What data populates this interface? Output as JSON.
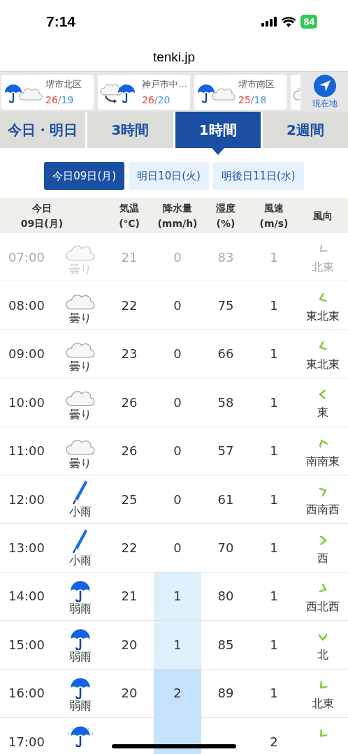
{
  "status_bar": {
    "time": "7:14",
    "battery": "84"
  },
  "site_title": "tenki.jp",
  "locations": [
    {
      "kind": "rain-cloud",
      "name": "堺市北区",
      "high": "26",
      "separator": "/",
      "low": "19"
    },
    {
      "kind": "cloud-then-rain",
      "name": "神戸市中…",
      "high": "26",
      "separator": "/",
      "low": "20"
    },
    {
      "kind": "rain-cloud",
      "name": "堺市南区",
      "high": "25",
      "separator": "/",
      "low": "18"
    },
    {
      "kind": "partial-cloud"
    }
  ],
  "current_location_button": "現在地",
  "tabs": [
    {
      "label": "今日・明日",
      "selected": false
    },
    {
      "label": "3時間",
      "selected": false
    },
    {
      "label": "1時間",
      "selected": true
    },
    {
      "label": "2週間",
      "selected": false
    }
  ],
  "days": [
    {
      "label": "今日09日(月)",
      "selected": true
    },
    {
      "label": "明日10日(火)",
      "selected": false
    },
    {
      "label": "明後日11日(水)",
      "selected": false
    }
  ],
  "table": {
    "columns": [
      [
        "今日",
        "09日(月)"
      ],
      [
        "気温",
        "(℃)"
      ],
      [
        "降水量",
        "(mm/h)"
      ],
      [
        "湿度",
        "(%)"
      ],
      [
        "風速",
        "(m/s)"
      ],
      [
        "風向"
      ]
    ],
    "rows": [
      {
        "time": "07:00",
        "past": true,
        "weather": {
          "kind": "cloudy",
          "label": "曇り"
        },
        "temp": "21",
        "precip": {
          "kind": "none",
          "value": "0"
        },
        "humidity": "83",
        "wind_speed": "1",
        "wind": {
          "kind": "NE",
          "label": "北東"
        }
      },
      {
        "time": "08:00",
        "past": false,
        "weather": {
          "kind": "cloudy",
          "label": "曇り"
        },
        "temp": "22",
        "precip": {
          "kind": "none",
          "value": "0"
        },
        "humidity": "75",
        "wind_speed": "1",
        "wind": {
          "kind": "ENE",
          "label": "東北東"
        }
      },
      {
        "time": "09:00",
        "past": false,
        "weather": {
          "kind": "cloudy",
          "label": "曇り"
        },
        "temp": "23",
        "precip": {
          "kind": "none",
          "value": "0"
        },
        "humidity": "66",
        "wind_speed": "1",
        "wind": {
          "kind": "ENE",
          "label": "東北東"
        }
      },
      {
        "time": "10:00",
        "past": false,
        "weather": {
          "kind": "cloudy",
          "label": "曇り"
        },
        "temp": "26",
        "precip": {
          "kind": "none",
          "value": "0"
        },
        "humidity": "58",
        "wind_speed": "1",
        "wind": {
          "kind": "E",
          "label": "東"
        }
      },
      {
        "time": "11:00",
        "past": false,
        "weather": {
          "kind": "cloudy",
          "label": "曇り"
        },
        "temp": "26",
        "precip": {
          "kind": "none",
          "value": "0"
        },
        "humidity": "57",
        "wind_speed": "1",
        "wind": {
          "kind": "SSE",
          "label": "南南東"
        }
      },
      {
        "time": "12:00",
        "past": false,
        "weather": {
          "kind": "closed-umbrella",
          "label": "小雨"
        },
        "temp": "25",
        "precip": {
          "kind": "none",
          "value": "0"
        },
        "humidity": "61",
        "wind_speed": "1",
        "wind": {
          "kind": "WSW",
          "label": "西南西"
        }
      },
      {
        "time": "13:00",
        "past": false,
        "weather": {
          "kind": "closed-umbrella",
          "label": "小雨"
        },
        "temp": "22",
        "precip": {
          "kind": "none",
          "value": "0"
        },
        "humidity": "70",
        "wind_speed": "1",
        "wind": {
          "kind": "W",
          "label": "西"
        }
      },
      {
        "time": "14:00",
        "past": false,
        "weather": {
          "kind": "umbrella",
          "label": "弱雨"
        },
        "temp": "21",
        "precip": {
          "kind": "light",
          "value": "1"
        },
        "humidity": "80",
        "wind_speed": "1",
        "wind": {
          "kind": "WNW",
          "label": "西北西"
        }
      },
      {
        "time": "15:00",
        "past": false,
        "weather": {
          "kind": "umbrella",
          "label": "弱雨"
        },
        "temp": "20",
        "precip": {
          "kind": "light",
          "value": "1"
        },
        "humidity": "85",
        "wind_speed": "1",
        "wind": {
          "kind": "N",
          "label": "北"
        }
      },
      {
        "time": "16:00",
        "past": false,
        "weather": {
          "kind": "umbrella",
          "label": "弱雨"
        },
        "temp": "20",
        "precip": {
          "kind": "medium",
          "value": "2"
        },
        "humidity": "89",
        "wind_speed": "1",
        "wind": {
          "kind": "NE",
          "label": "北東"
        }
      },
      {
        "time": "17:00",
        "past": false,
        "weather": {
          "kind": "umbrella-rain"
        },
        "precip": {
          "kind": "medium"
        },
        "wind_speed": "2",
        "wind": {
          "kind": "NE"
        }
      }
    ]
  }
}
